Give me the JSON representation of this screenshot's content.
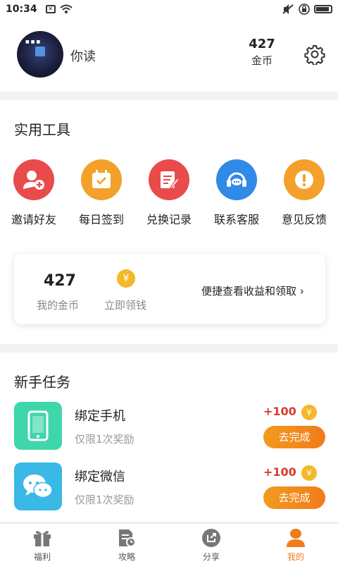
{
  "status_bar": {
    "time": "10:34"
  },
  "profile": {
    "username": "你读",
    "coin_count": "427",
    "coin_label": "金币"
  },
  "tools": {
    "title": "实用工具",
    "items": [
      {
        "label": "邀请好友",
        "icon": "add-user-icon",
        "color": "#e94b4b"
      },
      {
        "label": "每日签到",
        "icon": "calendar-check-icon",
        "color": "#f3a12b"
      },
      {
        "label": "兑换记录",
        "icon": "edit-note-icon",
        "color": "#e94b4b"
      },
      {
        "label": "联系客服",
        "icon": "headset-icon",
        "color": "#2f8ae8"
      },
      {
        "label": "意见反馈",
        "icon": "alert-icon",
        "color": "#f3a12b"
      }
    ]
  },
  "coin_card": {
    "coin_value": "427",
    "coin_label": "我的金币",
    "withdraw_label": "立即领钱",
    "link_text": "便捷查看收益和领取 ›"
  },
  "tasks": {
    "title": "新手任务",
    "items": [
      {
        "name": "绑定手机",
        "desc": "仅限1次奖励",
        "reward": "+100",
        "button": "去完成",
        "icon": "phone-icon",
        "color": "#3fd6ab"
      },
      {
        "name": "绑定微信",
        "desc": "仅限1次奖励",
        "reward": "+100",
        "button": "去完成",
        "icon": "wechat-icon",
        "color": "#3ab8e6"
      }
    ]
  },
  "tab_bar": {
    "items": [
      {
        "label": "福利",
        "icon": "gift-icon"
      },
      {
        "label": "攻略",
        "icon": "guide-icon"
      },
      {
        "label": "分享",
        "icon": "share-icon"
      },
      {
        "label": "我的",
        "icon": "user-icon",
        "active": true
      }
    ]
  },
  "colors": {
    "accent": "#f07c1b",
    "reward_red": "#d63b2e",
    "coin_gold": "#f4b828"
  }
}
